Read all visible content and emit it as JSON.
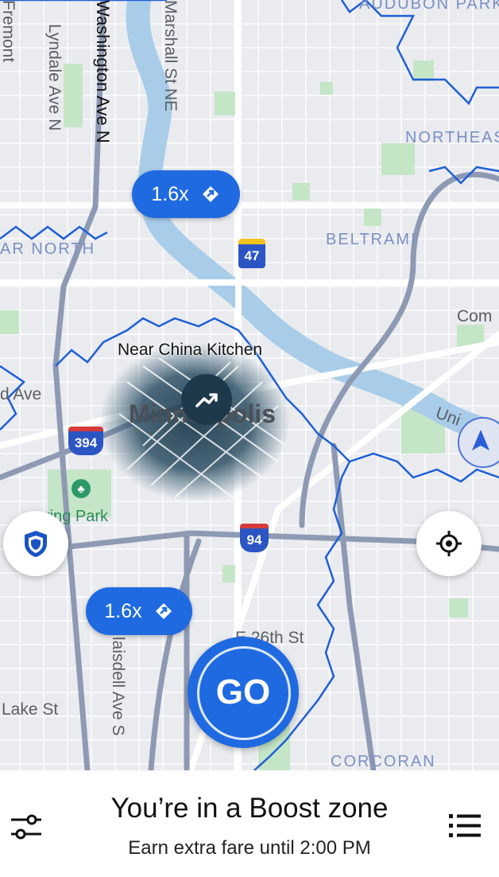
{
  "map": {
    "district_labels": [
      "AUDUBON PARK",
      "NORTHEAST PARK",
      "BELTRAMI",
      "AR NORTH",
      "CORCORAN"
    ],
    "street_labels": [
      "Washington Ave N",
      "Marshall St NE",
      "Lyndale Ave N",
      "Fremont",
      "d Ave",
      "Lake St",
      "E 26th St",
      "laisdell Ave S",
      "Com",
      "Uni",
      "ring Park"
    ],
    "city_label": "Minneapolis",
    "highway_shields": [
      "47",
      "394",
      "94"
    ],
    "location_label": "Near China Kitchen",
    "colors": {
      "background": "#eaebef",
      "water": "#a9cde9",
      "park": "#c5e5c7",
      "boost_border": "#1e5fd6",
      "accent": "#1f6ae0"
    }
  },
  "boost_pills": [
    {
      "multiplier": "1.6x",
      "icon": "boost-arrow-icon"
    },
    {
      "multiplier": "1.6x",
      "icon": "boost-arrow-icon"
    }
  ],
  "buttons": {
    "go_label": "GO",
    "safety_icon": "shield-icon",
    "locate_icon": "crosshair-icon",
    "compass_icon": "navigation-arrow-icon",
    "filters_icon": "sliders-icon",
    "menu_icon": "list-icon"
  },
  "status": {
    "title": "You’re in a Boost zone",
    "subtitle": "Earn extra fare until 2:00 PM"
  }
}
